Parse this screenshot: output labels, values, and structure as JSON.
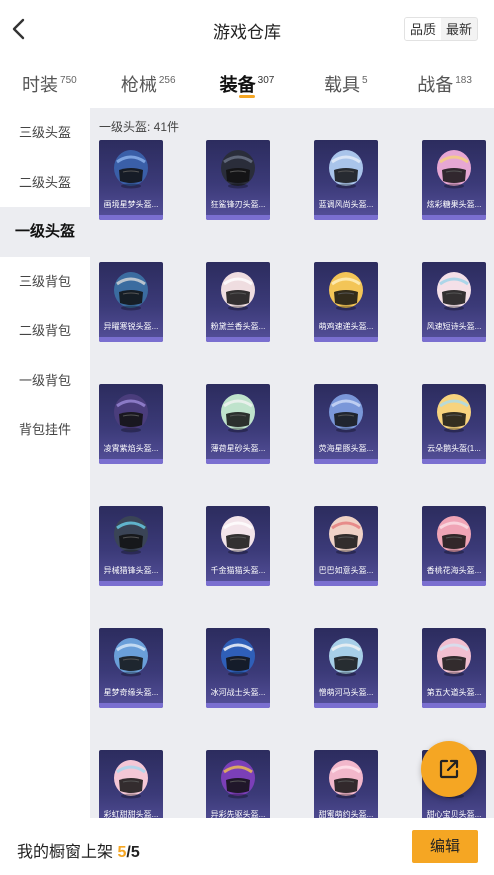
{
  "header": {
    "title": "游戏仓库",
    "back_icon": "chevron-left-icon",
    "sort_options": [
      "品质",
      "最新"
    ],
    "sort_selected": "品质"
  },
  "tabs": [
    {
      "label": "时装",
      "count": "750"
    },
    {
      "label": "枪械",
      "count": "256"
    },
    {
      "label": "装备",
      "count": "307",
      "active": true
    },
    {
      "label": "载具",
      "count": "5"
    },
    {
      "label": "战备",
      "count": "183"
    }
  ],
  "sidebar": {
    "items": [
      "三级头盔",
      "二级头盔",
      "一级头盔",
      "三级背包",
      "二级背包",
      "一级背包",
      "背包挂件"
    ],
    "active_index": 2
  },
  "section_title": "一级头盔: 41件",
  "items": [
    {
      "name": "画境星梦头盔...",
      "color": "#3a5fa8",
      "accent": "#8fb4ee"
    },
    {
      "name": "狂鲨锋刃头盔...",
      "color": "#2a2d3a",
      "accent": "#6d7488"
    },
    {
      "name": "蓝调风尚头盔...",
      "color": "#a9c4ea",
      "accent": "#e6eef9"
    },
    {
      "name": "炫彩糖果头盔...",
      "color": "#e7a7d4",
      "accent": "#f6d37a"
    },
    {
      "name": "异曜寒锐头盔...",
      "color": "#3b6ca0",
      "accent": "#d9d9d9"
    },
    {
      "name": "粉黛兰香头盔...",
      "color": "#efdde0",
      "accent": "#ffffff"
    },
    {
      "name": "萌鸡速递头盔...",
      "color": "#f3c557",
      "accent": "#fff1c2"
    },
    {
      "name": "风速短诗头盔...",
      "color": "#f4e0e8",
      "accent": "#9ad3e8"
    },
    {
      "name": "凌霄紫焰头盔...",
      "color": "#4a3d7c",
      "accent": "#9b8ad8"
    },
    {
      "name": "薄荷星砂头盔...",
      "color": "#bfe3cc",
      "accent": "#f2f2f2"
    },
    {
      "name": "荧海星豚头盔...",
      "color": "#7a97d9",
      "accent": "#cfdcf7"
    },
    {
      "name": "云朵鹅头盔(1...",
      "color": "#f7d37e",
      "accent": "#a8dcef"
    },
    {
      "name": "异械猎锋头盔...",
      "color": "#3a4456",
      "accent": "#6ad0e8"
    },
    {
      "name": "千金猫猫头盔...",
      "color": "#f3e4ea",
      "accent": "#ffffff"
    },
    {
      "name": "巴巴如意头盔...",
      "color": "#f0d2c6",
      "accent": "#e57a7a"
    },
    {
      "name": "香桃花海头盔...",
      "color": "#f0a4b6",
      "accent": "#fbe0e7"
    },
    {
      "name": "星梦奇缘头盔...",
      "color": "#6a9fd9",
      "accent": "#d8e8f8"
    },
    {
      "name": "冰河战士头盔...",
      "color": "#2f5fb8",
      "accent": "#ffffff"
    },
    {
      "name": "憎萌河马头盔...",
      "color": "#a7cfe8",
      "accent": "#f4f4f4"
    },
    {
      "name": "第五大道头盔...",
      "color": "#f2bfd0",
      "accent": "#d2e4f2"
    },
    {
      "name": "彩虹甜甜头盔...",
      "color": "#f4c7d6",
      "accent": "#a4d8ef"
    },
    {
      "name": "异彩先驱头盔...",
      "color": "#7b3fb8",
      "accent": "#f2c24e"
    },
    {
      "name": "甜蜜萌约头盔...",
      "color": "#f2b7cb",
      "accent": "#ffe3ec"
    },
    {
      "name": "甜心宝贝头盔...",
      "color": "#f4c6d8",
      "accent": "#ffffff"
    }
  ],
  "fab_icon": "share-external-icon",
  "bottom": {
    "label": "我的橱窗上架",
    "shelf_count": "5",
    "shelf_separator": "/",
    "shelf_total": "5",
    "edit_label": "编辑"
  },
  "colors": {
    "accent": "#f5a623",
    "content_bg": "#ecedf1",
    "card_bg": "#3b3a78"
  }
}
